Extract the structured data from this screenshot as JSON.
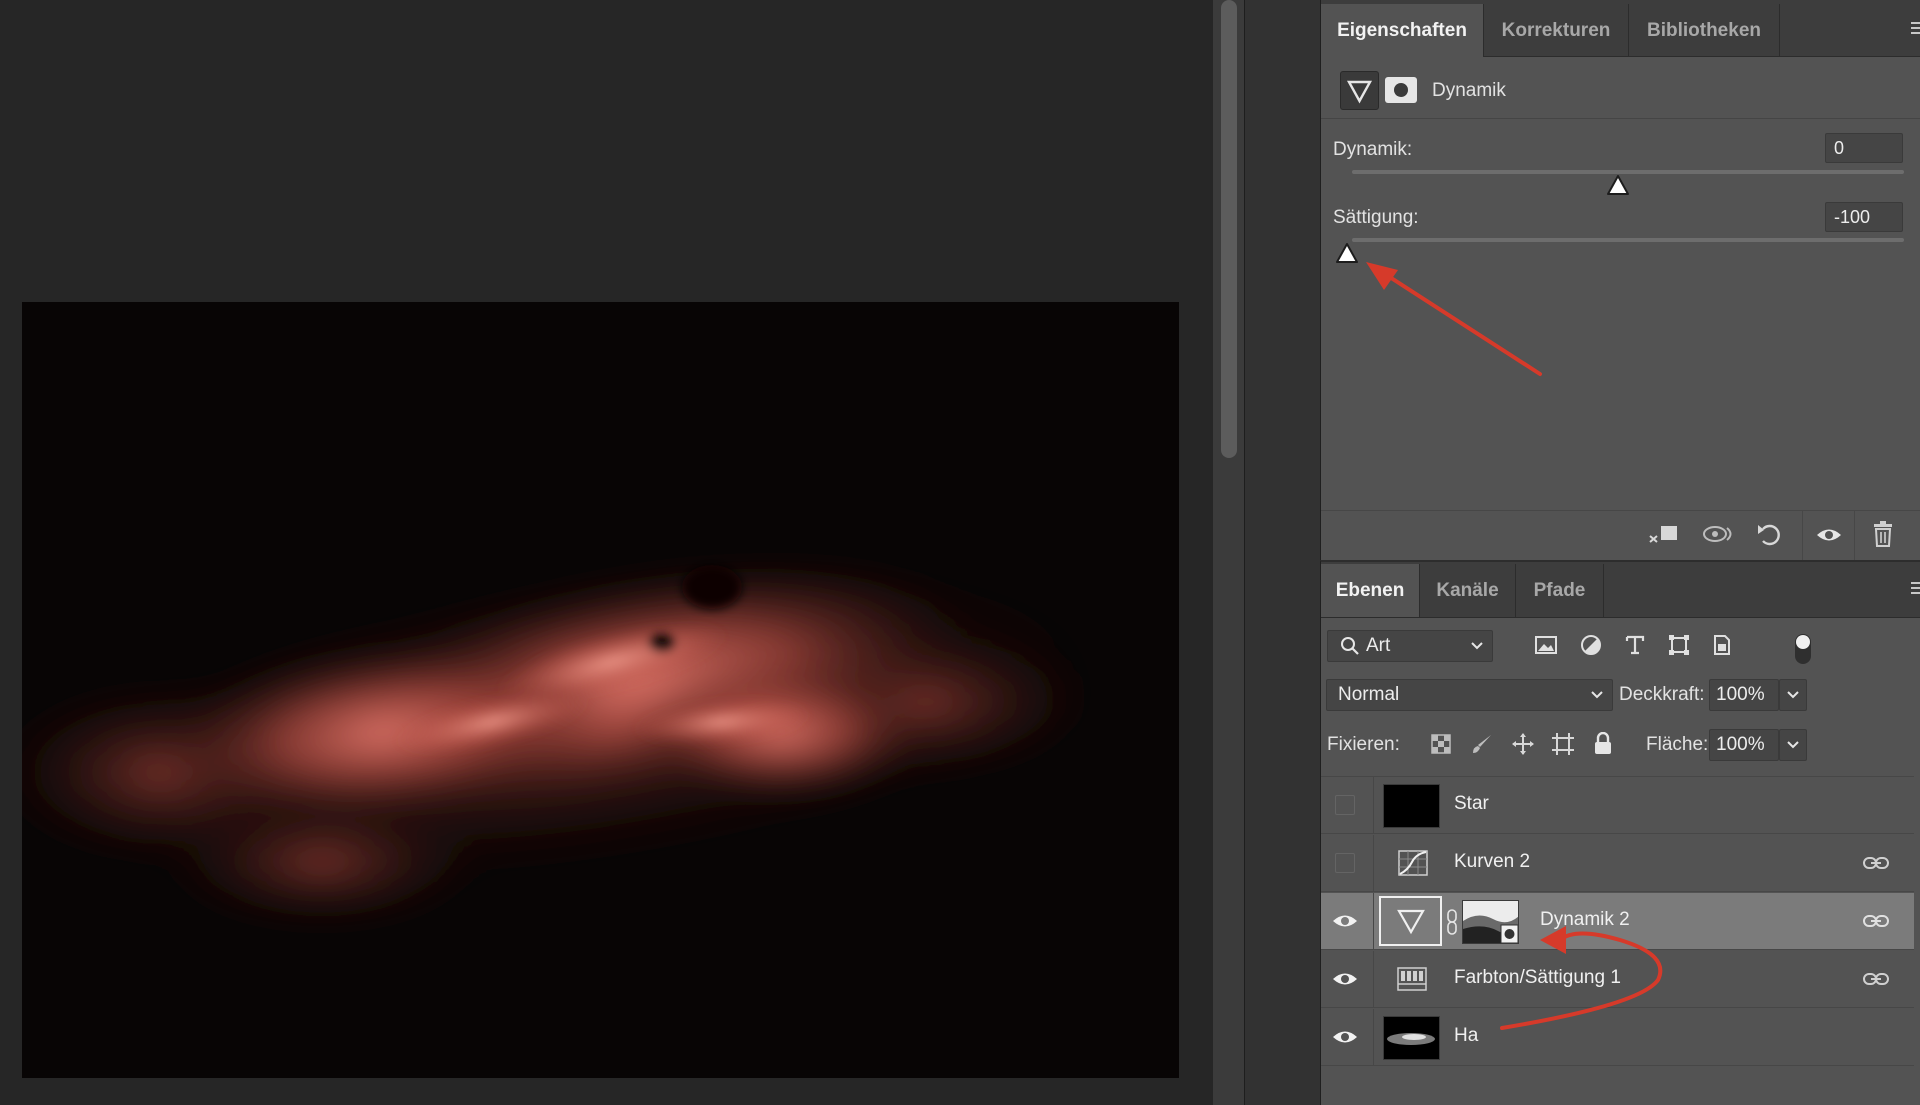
{
  "properties_panel": {
    "tabs": [
      "Eigenschaften",
      "Korrekturen",
      "Bibliotheken"
    ],
    "active_tab": "Eigenschaften",
    "header_title": "Dynamik",
    "sliders": [
      {
        "label": "Dynamik:",
        "value": "0",
        "thumb_fraction": 0.5
      },
      {
        "label": "Sättigung:",
        "value": "-100",
        "thumb_fraction": 0.0
      }
    ],
    "footer_icons": [
      "clip-to-layer-icon",
      "view-previous-state-icon",
      "reset-icon",
      "toggle-visibility-icon",
      "delete-icon"
    ]
  },
  "layers_panel": {
    "tabs": [
      "Ebenen",
      "Kanäle",
      "Pfade"
    ],
    "active_tab": "Ebenen",
    "filter": {
      "value": "Art"
    },
    "filter_icons": [
      "pixel-layer-filter-icon",
      "adjustment-layer-filter-icon",
      "type-layer-filter-icon",
      "shape-layer-filter-icon",
      "smart-object-filter-icon"
    ],
    "blend_mode": "Normal",
    "opacity_label": "Deckkraft:",
    "opacity_value": "100%",
    "lock_label": "Fixieren:",
    "lock_icons": [
      "lock-transparent-pixels-icon",
      "lock-image-pixels-icon",
      "lock-position-icon",
      "lock-artboard-icon",
      "lock-all-icon"
    ],
    "fill_label": "Fläche:",
    "fill_value": "100%",
    "layers": [
      {
        "name": "Star",
        "visible": false,
        "kind": "pixel",
        "selected": false,
        "linked": false
      },
      {
        "name": "Kurven 2",
        "visible": false,
        "kind": "curves",
        "selected": false,
        "linked": true
      },
      {
        "name": "Dynamik 2",
        "visible": true,
        "kind": "vibrance",
        "selected": true,
        "linked": true
      },
      {
        "name": "Farbton/Sättigung 1",
        "visible": true,
        "kind": "hue-saturation",
        "selected": false,
        "linked": true
      },
      {
        "name": "Ha",
        "visible": true,
        "kind": "pixel",
        "selected": false,
        "linked": false
      }
    ]
  },
  "colors": {
    "panel_bg": "#535353",
    "tab_bar_bg": "#3d3d3d",
    "selected_layer_bg": "#7b7b7b",
    "annotation_red": "#d63a2a",
    "nebula_tint": "#c2564b"
  }
}
